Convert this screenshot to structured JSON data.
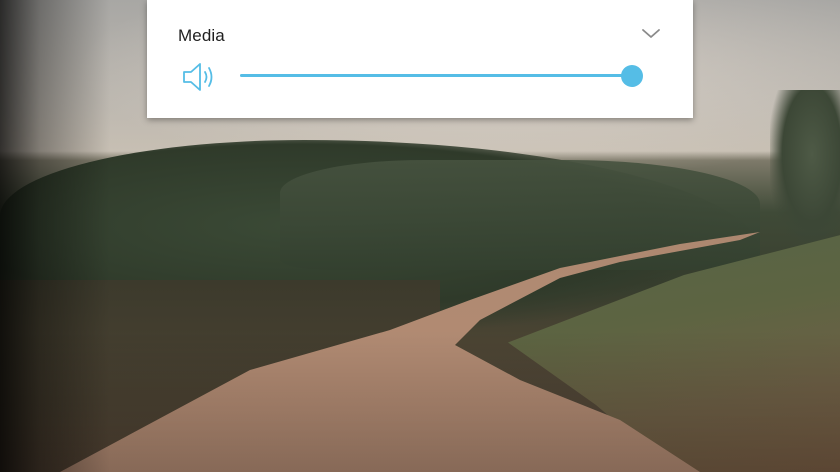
{
  "volume_panel": {
    "title": "Media",
    "stream": "media",
    "level": 1.0,
    "speaker_icon": "speaker-volume-icon",
    "expand_icon": "chevron-down-icon",
    "accent_color": "#55bde6",
    "track_color": "#cfe8f3"
  },
  "background": {
    "content": "video-frame"
  }
}
